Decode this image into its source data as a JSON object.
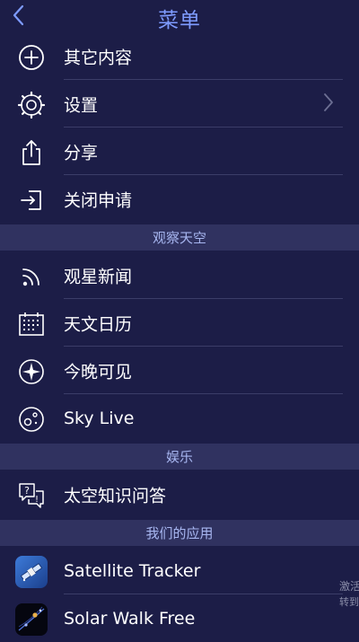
{
  "header": {
    "title": "菜单",
    "back_icon": "chevron-left-icon"
  },
  "menu_top": [
    {
      "label": "其它内容",
      "icon": "plus-circle-icon"
    },
    {
      "label": "设置",
      "icon": "gear-icon",
      "has_chevron": true
    },
    {
      "label": "分享",
      "icon": "share-icon"
    },
    {
      "label": "关闭申请",
      "icon": "sign-in-icon"
    }
  ],
  "section_observe": {
    "title": "观察天空"
  },
  "menu_observe": [
    {
      "label": "观星新闻",
      "icon": "rss-icon"
    },
    {
      "label": "天文日历",
      "icon": "calendar-icon"
    },
    {
      "label": "今晚可见",
      "icon": "compass-icon"
    },
    {
      "label": "Sky Live",
      "icon": "moon-icon"
    }
  ],
  "section_fun": {
    "title": "娱乐"
  },
  "menu_fun": [
    {
      "label": "太空知识问答",
      "icon": "quiz-icon"
    }
  ],
  "section_apps": {
    "title": "我们的应用"
  },
  "menu_apps": [
    {
      "label": "Satellite Tracker",
      "icon": "satellite-app-icon"
    },
    {
      "label": "Solar Walk Free",
      "icon": "solar-walk-app-icon"
    }
  ],
  "side_note": {
    "line1": "激活",
    "line2": "转到"
  },
  "colors": {
    "background": "#1c1d47",
    "section": "#303260",
    "accent": "#7e9bff",
    "divider": "#3b3d68"
  }
}
